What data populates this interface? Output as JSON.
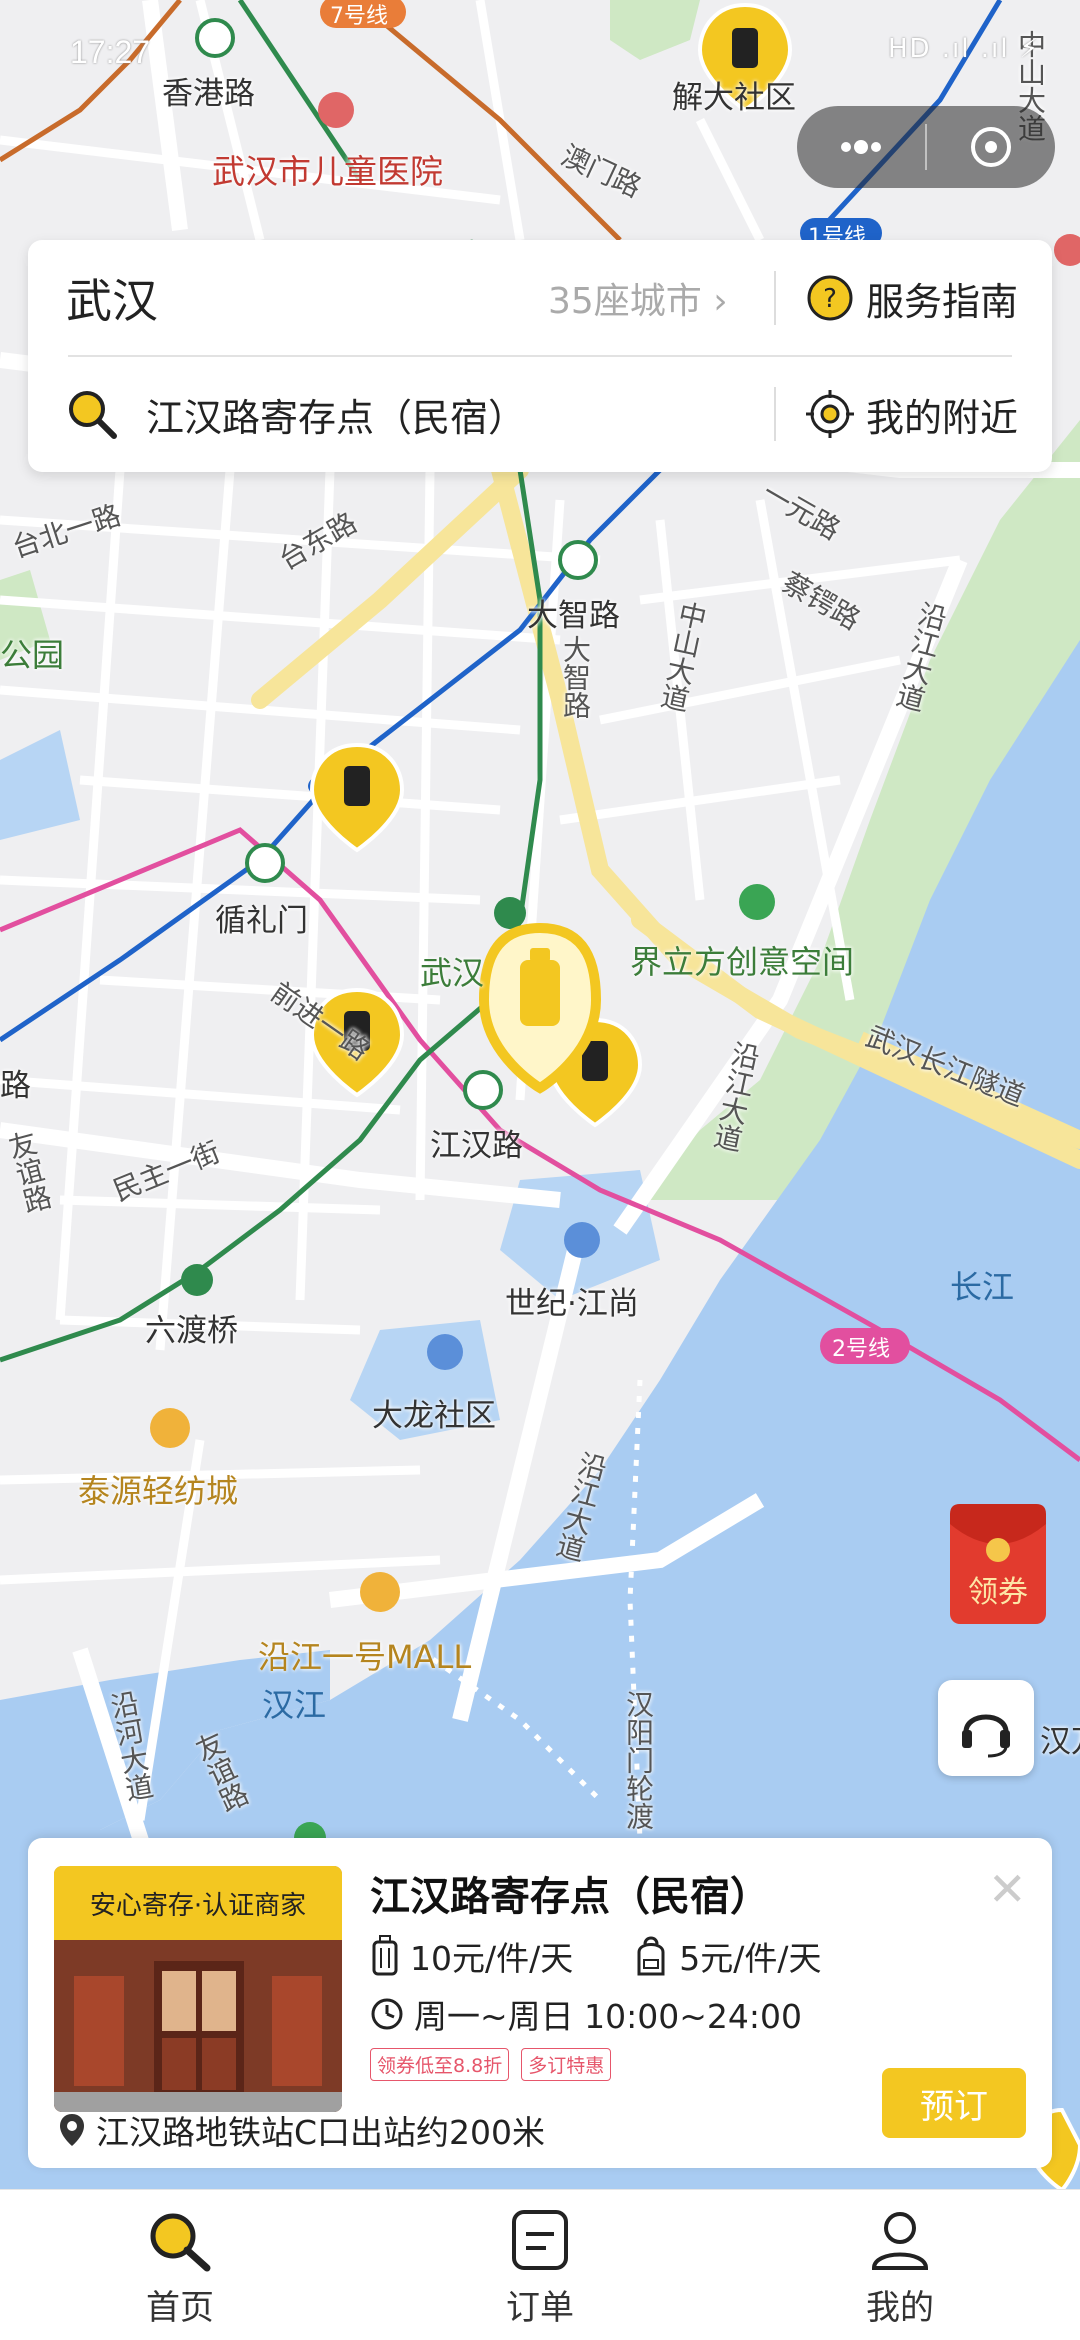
{
  "status_bar": {
    "time": "17:27",
    "right": "HD .ıl .ıl ⚡"
  },
  "map": {
    "labels": {
      "hongkong_rd": "香港路",
      "line7": "7号线",
      "children_hospital": "武汉市儿童医院",
      "jiefang_community": "解大社区",
      "aomen_rd": "澳门路",
      "line1": "1号线",
      "zhongshan_top": "中山大道",
      "taibei_rd": "台北一路",
      "taidong_rd": "台东路",
      "park": "公园",
      "yiyuan_rd": "一元路",
      "caie_rd": "蔡锷路",
      "yanjiang_rd": "沿江大道",
      "dazhi_rd": "大智路",
      "dazhi_rd_v": "大智路",
      "zhongshan_mid": "中山大道",
      "xunlimen": "循礼门",
      "jielifang": "界立方创意空间",
      "wuhan_label": "武汉",
      "qianjin_rd": "前进一路",
      "jianghan_rd": "江汉路",
      "yanjiang_mid": "沿江大道",
      "tunnel": "武汉长江隧道",
      "road_left": "路",
      "youyi_rd": "友谊路",
      "minzhu_st": "民主一街",
      "century": "世纪·江尚",
      "yangtze": "长江",
      "line2": "2号线",
      "liudu_bridge": "六渡桥",
      "dalong": "大龙社区",
      "taiyuan": "泰源轻纺城",
      "yanjiang_low": "沿江大道",
      "yanjiang_mall": "沿江一号MALL",
      "hanjiang": "汉江",
      "yanhe_rd": "沿河大道",
      "youyi_rd2": "友谊路",
      "hanyang_ferry": "汉阳门轮渡",
      "wan_edge": "汉万",
      "coupon": "领券"
    }
  },
  "top_card": {
    "city": "武汉",
    "city_count": "35座城市",
    "guide": "服务指南",
    "search": "江汉路寄存点（民宿）",
    "nearby": "我的附近"
  },
  "store": {
    "badge": "安心寄存·认证商家",
    "name": "江汉路寄存点（民宿）",
    "price_suitcase": "10元/件/天",
    "price_bag": "5元/件/天",
    "hours": "周一~周日 10:00~24:00",
    "tags": [
      "领券低至8.8折",
      "多订特惠"
    ],
    "location": "江汉路地铁站C口出站约200米",
    "book": "预订"
  },
  "tabbar": [
    {
      "label": "首页",
      "icon": "home-search-icon"
    },
    {
      "label": "订单",
      "icon": "order-icon"
    },
    {
      "label": "我的",
      "icon": "profile-icon"
    }
  ],
  "colors": {
    "accent": "#f3c721",
    "water": "#a9ccf2",
    "line1": "#1f63c9",
    "line2": "#e24f9f",
    "line6": "#2f8a4d",
    "line7": "#c86b2b"
  }
}
